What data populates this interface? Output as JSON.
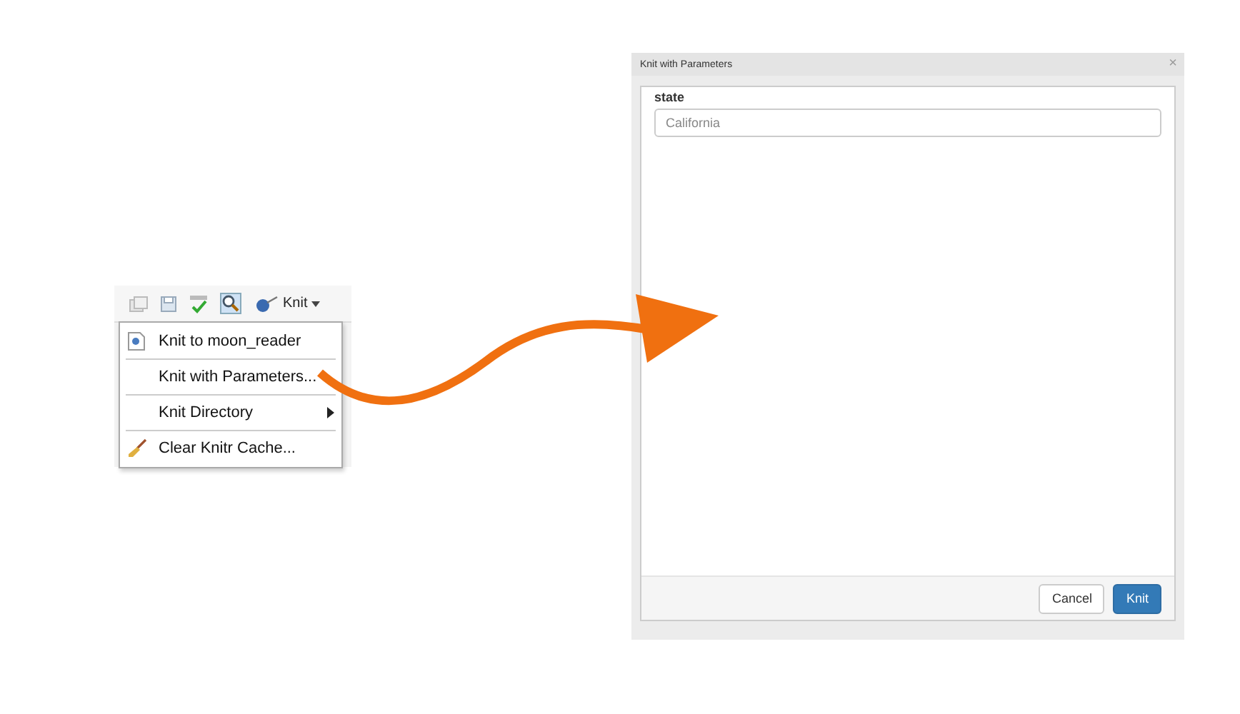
{
  "toolbar": {
    "knit_button": "Knit"
  },
  "menu": {
    "items": [
      {
        "label": "Knit to moon_reader",
        "kind": "doc"
      },
      {
        "label": "Knit with Parameters...",
        "kind": "plain"
      },
      {
        "label": "Knit Directory",
        "kind": "submenu"
      },
      {
        "label": "Clear Knitr Cache...",
        "kind": "broom"
      }
    ]
  },
  "dialog": {
    "title": "Knit with Parameters",
    "close": "×",
    "params": [
      {
        "label": "state",
        "value": "California"
      }
    ],
    "buttons": [
      {
        "label": "Cancel",
        "kind": "default"
      },
      {
        "label": "Knit",
        "kind": "primary"
      }
    ]
  }
}
